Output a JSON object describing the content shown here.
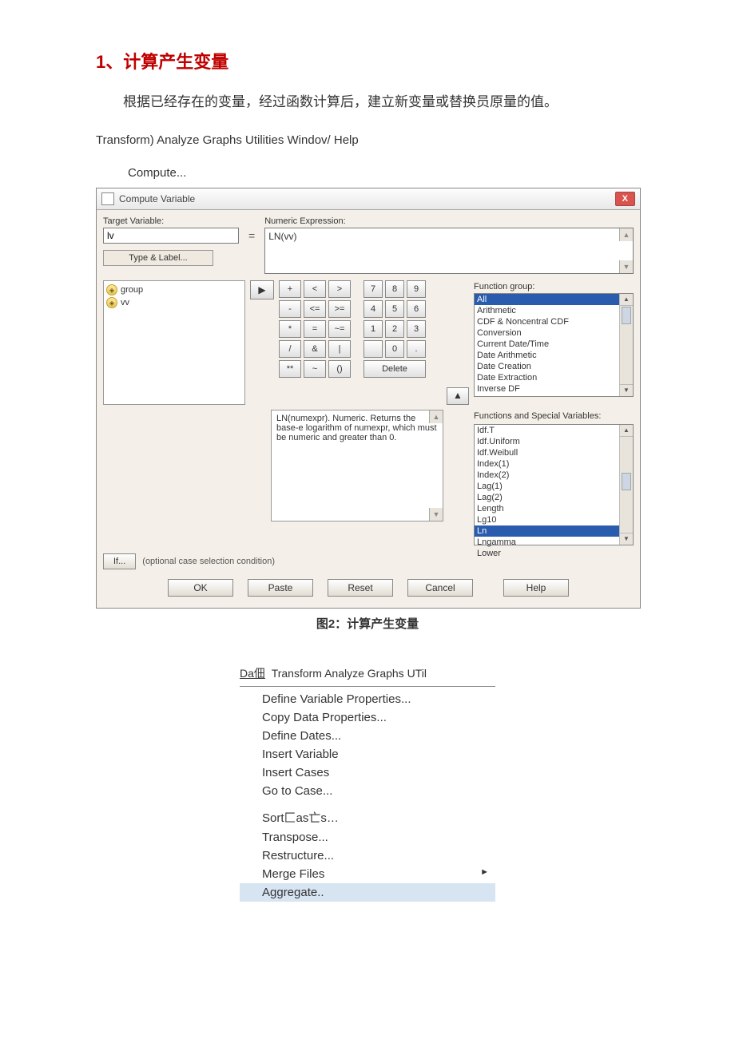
{
  "doc": {
    "title": "1、计算产生变量",
    "body": "根据已经存在的变量，经过函数计算后，建立新变量或替换员原量的值。",
    "menu_path": "Transform) Analyze Graphs Utilities Windov/ Help",
    "menu_sub": "Compute...",
    "caption": "图2：计算产生变量"
  },
  "dialog": {
    "title": "Compute Variable",
    "close": "X",
    "target_label": "Target Variable:",
    "target_value": "lv",
    "type_label_btn": "Type & Label...",
    "eq": "=",
    "numexpr_label": "Numeric Expression:",
    "numexpr_value": "LN(vv)",
    "move_btn": "▶",
    "vars": [
      "group",
      "vv"
    ],
    "pad": {
      "r1": [
        "+",
        "<",
        ">",
        "7",
        "8",
        "9"
      ],
      "r2": [
        "-",
        "<=",
        ">=",
        "4",
        "5",
        "6"
      ],
      "r3": [
        "*",
        "=",
        "~=",
        "1",
        "2",
        "3"
      ],
      "r4": [
        "/",
        "&",
        "|",
        "",
        "0",
        "."
      ],
      "r5_a": [
        "**",
        "~",
        "()"
      ],
      "delete": "Delete"
    },
    "fg_label": "Function group:",
    "fg_items": [
      "All",
      "Arithmetic",
      "CDF & Noncentral CDF",
      "Conversion",
      "Current Date/Time",
      "Date Arithmetic",
      "Date Creation",
      "Date Extraction",
      "Inverse DF"
    ],
    "fn_label": "Functions and Special Variables:",
    "fn_items": [
      "Idf.T",
      "Idf.Uniform",
      "Idf.Weibull",
      "Index(1)",
      "Index(2)",
      "Lag(1)",
      "Lag(2)",
      "Length",
      "Lg10",
      "Ln",
      "Lngamma",
      "Lower"
    ],
    "desc": "LN(numexpr). Numeric. Returns the base-e logarithm of numexpr, which must be numeric and greater than 0.",
    "up_arrow": "▲",
    "if_btn": "If...",
    "if_text": "(optional case selection condition)",
    "buttons": {
      "ok": "OK",
      "paste": "Paste",
      "reset": "Reset",
      "cancel": "Cancel",
      "help": "Help"
    }
  },
  "menu2": {
    "bar_left": "Da佃",
    "bar_rest": "Transform Analyze Graphs UTil",
    "items": [
      "Define Variable Properties...",
      "Copy Data Properties...",
      "Define Dates...",
      "Insert Variable",
      "Insert Cases",
      "Go to Case...",
      "Sort匚as亡s…",
      "Transpose...",
      "Restructure...",
      "Merge Files",
      "Aggregate.."
    ],
    "submenu_idx": 9,
    "highlight_idx": 10,
    "gap_after_idx": 5
  }
}
